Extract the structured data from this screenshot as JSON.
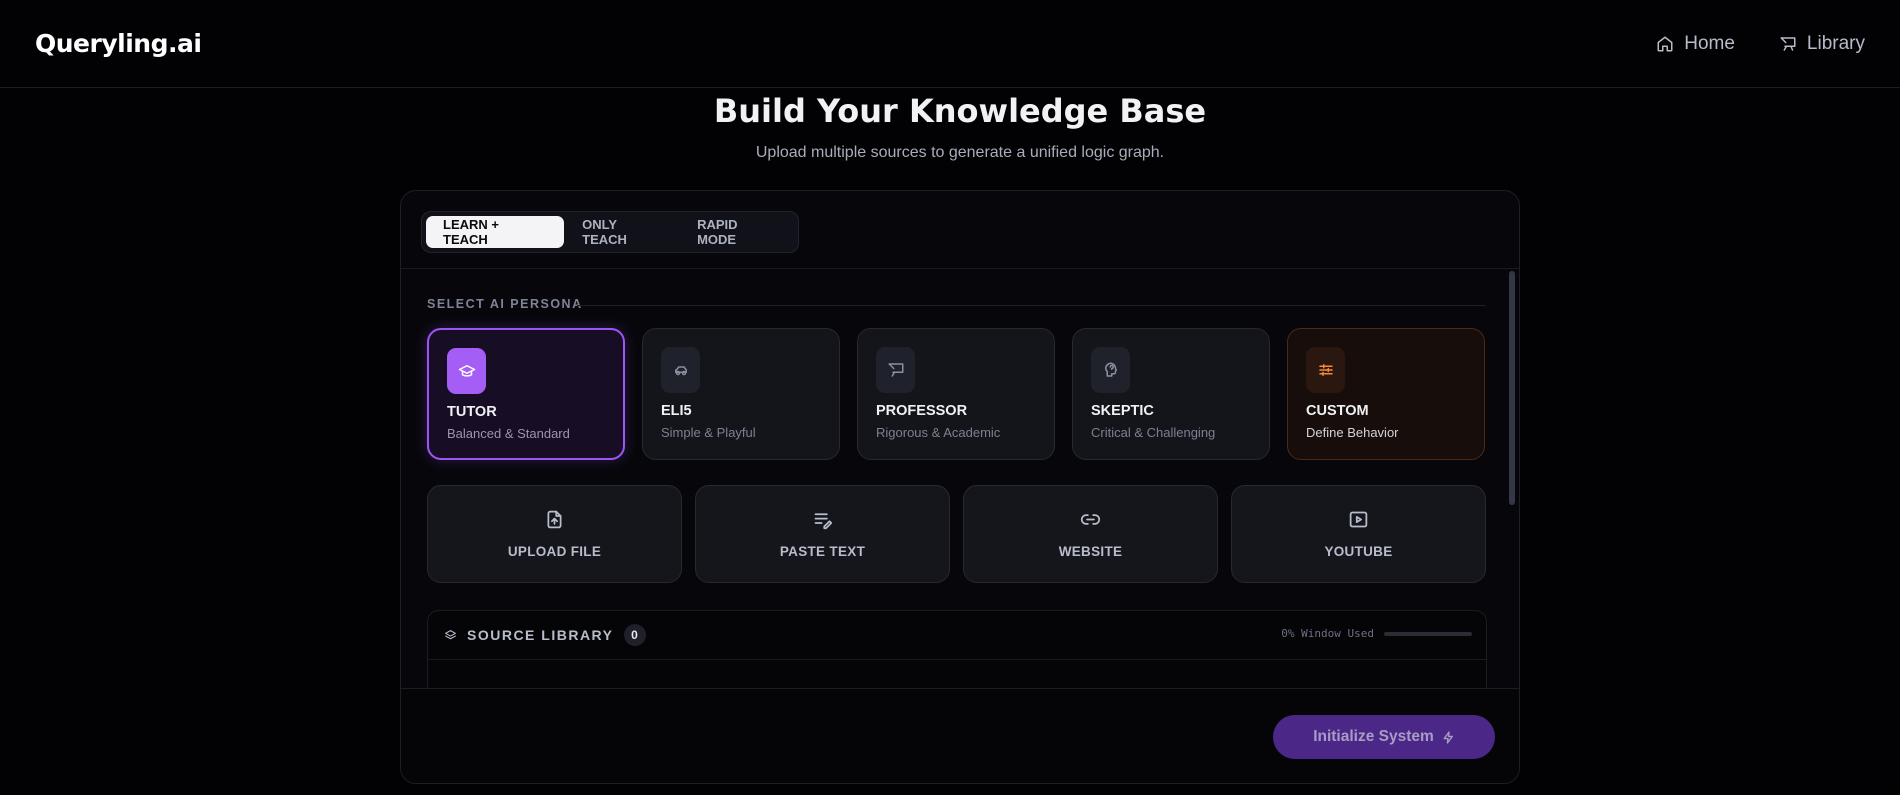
{
  "header": {
    "logo": "Queryling.ai",
    "nav": [
      {
        "label": "Home",
        "icon": "home-icon"
      },
      {
        "label": "Library",
        "icon": "library-icon"
      }
    ]
  },
  "hero": {
    "title": "Build Your Knowledge Base",
    "subtitle": "Upload multiple sources to generate a unified logic graph."
  },
  "modes": {
    "tabs": [
      "LEARN + TEACH",
      "ONLY TEACH",
      "RAPID MODE"
    ],
    "active": "LEARN + TEACH"
  },
  "persona": {
    "section_label": "SELECT AI PERSONA",
    "items": [
      {
        "name": "TUTOR",
        "desc": "Balanced & Standard",
        "icon": "graduation-cap-icon",
        "selected": true
      },
      {
        "name": "ELI5",
        "desc": "Simple & Playful",
        "icon": "toy-car-icon",
        "selected": false
      },
      {
        "name": "PROFESSOR",
        "desc": "Rigorous & Academic",
        "icon": "presentation-icon",
        "selected": false
      },
      {
        "name": "SKEPTIC",
        "desc": "Critical & Challenging",
        "icon": "thinking-head-icon",
        "selected": false
      },
      {
        "name": "CUSTOM",
        "desc": "Define Behavior",
        "icon": "sliders-icon",
        "selected": false
      }
    ]
  },
  "sources": [
    {
      "label": "UPLOAD FILE",
      "icon": "file-upload-icon"
    },
    {
      "label": "PASTE TEXT",
      "icon": "text-edit-icon"
    },
    {
      "label": "WEBSITE",
      "icon": "link-icon"
    },
    {
      "label": "YOUTUBE",
      "icon": "video-play-icon"
    }
  ],
  "library": {
    "title": "SOURCE LIBRARY",
    "count": "0",
    "usage_text": "0% Window Used",
    "usage_fraction": 0
  },
  "footer": {
    "button": "Initialize System"
  },
  "colors": {
    "accent": "#9d55f5",
    "custom_icon": "#f58a3a",
    "button_bg": "#4b2888"
  }
}
